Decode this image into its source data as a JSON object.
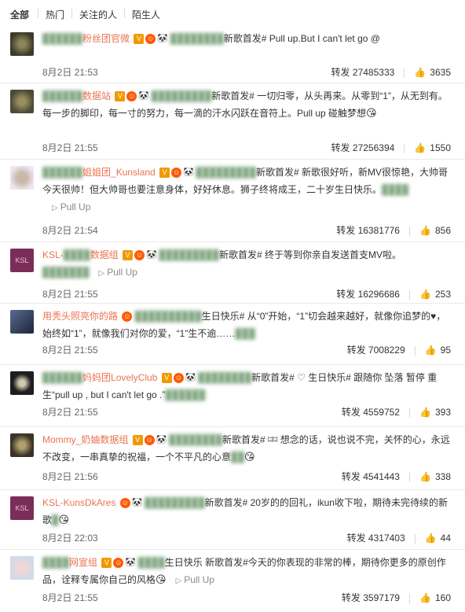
{
  "filters": [
    "全部",
    "热门",
    "关注的人",
    "陌生人"
  ],
  "comments": [
    {
      "user": "粉丝团官微",
      "text": "新歌首发# Pull up.But I can't let go @",
      "date": "8月2日 21:53",
      "repost_label": "转发",
      "reposts": "27485333",
      "likes": "3635",
      "avatar_color": "#3c3a2a"
    },
    {
      "user": "数据站",
      "text": "新歌首发# 一切归零，从头再来。从零到“1”，从无到有。每一步的脚印，每一寸的努力，每一滴的汗水闪跃在音符上。Pull up 碰触梦想",
      "date": "8月2日 21:55",
      "repost_label": "转发",
      "reposts": "27256394",
      "likes": "1550",
      "avatar_color": "#4a4a36"
    },
    {
      "user": "姐姐团_Kunsland",
      "text": "新歌首发# 新歌很好听，新MV很惊艳，大帅哥今天很帅！但大帅哥也要注意身体，好好休息。狮子终将成王，二十岁生日快乐。",
      "pullup": "Pull Up",
      "date": "8月2日 21:54",
      "repost_label": "转发",
      "reposts": "16381776",
      "likes": "856",
      "avatar_color": "#e8e0f0"
    },
    {
      "user": "KSL-",
      "user_suffix": "数据组",
      "text": "新歌首发# 终于等到你亲自发送首支MV啦。",
      "pullup": "Pull Up",
      "date": "8月2日 21:55",
      "repost_label": "转发",
      "reposts": "16296686",
      "likes": "253",
      "avatar_color": "#7b2d5a"
    },
    {
      "user": "用秃头照亮你的路",
      "text": "生日快乐# 从“0”开始，“1”切会越来越好，就像你追梦的♥，始终如“1”，就像我们对你的爱，“1”生不逾……",
      "date": "8月2日 21:55",
      "repost_label": "转发",
      "reposts": "7008229",
      "likes": "95",
      "avatar_color": "#2a3550"
    },
    {
      "user": "妈妈团LovelyClub",
      "text": "新歌首发# ♡ 生日快乐# 跟随你 坠落 暂停 重生“pull up , but I can't let go .”",
      "date": "8月2日 21:55",
      "repost_label": "转发",
      "reposts": "4559752",
      "likes": "393",
      "avatar_color": "#1e1e1e"
    },
    {
      "user": "Mommy_奶妯数据组",
      "text": "新歌首发# ⌑⌑ 想念的话，说也说不完，关怀的心，永远不改变，一串真挚的祝福，一个不平凡的心意",
      "date": "8月2日 21:56",
      "repost_label": "转发",
      "reposts": "4541443",
      "likes": "338",
      "avatar_color": "#3a3324"
    },
    {
      "user": "KSL-KunsDkAres",
      "text": "新歌首发# 20岁的的回礼，ikun收下啦，期待未完待续的新歌",
      "date": "8月2日 22:03",
      "repost_label": "转发",
      "reposts": "4317403",
      "likes": "44",
      "avatar_color": "#7b2d5a"
    },
    {
      "user": "网宣组",
      "text": "生日快乐 新歌首发#今天的你表现的非常的棒，期待你更多的原创作品，诠释专属你自己的风格",
      "pullup": "Pull Up",
      "date": "8月2日 21:55",
      "repost_label": "转发",
      "reposts": "3597179",
      "likes": "160",
      "avatar_color": "#cfdbe8"
    }
  ]
}
